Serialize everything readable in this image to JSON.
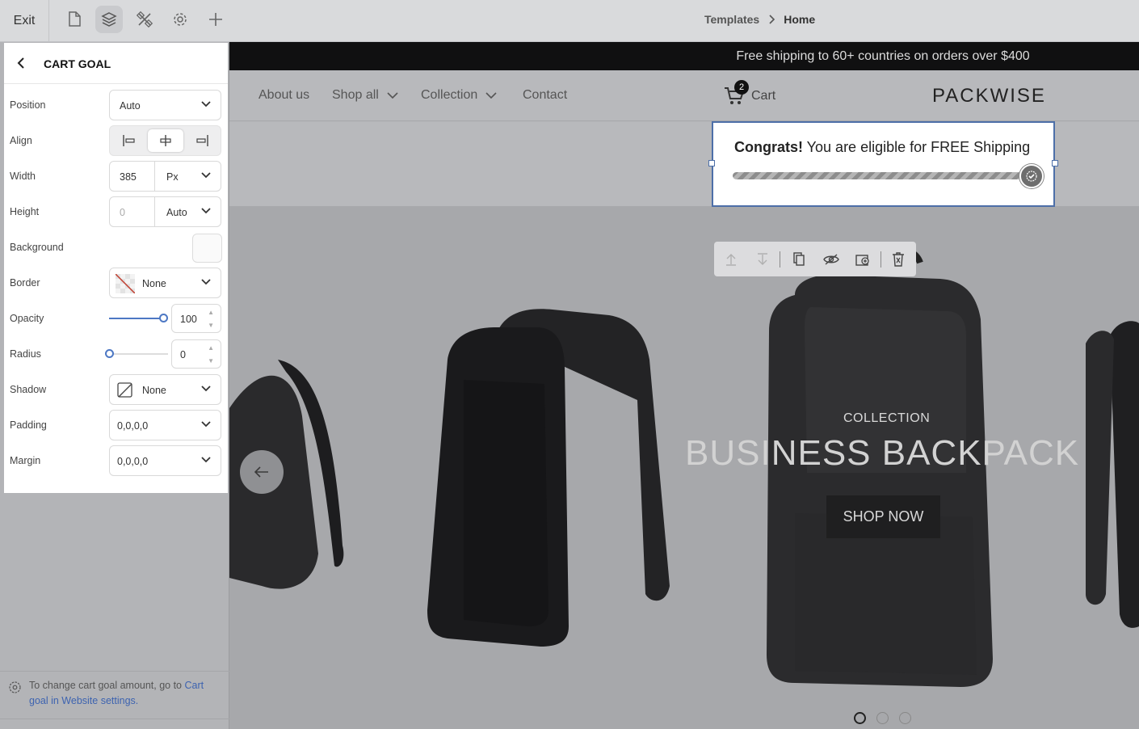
{
  "topbar": {
    "exit_label": "Exit",
    "icons": [
      "page-icon",
      "layers-icon",
      "tools-icon",
      "gear-icon",
      "plus-icon"
    ],
    "breadcrumb": {
      "parent": "Templates",
      "current": "Home"
    }
  },
  "panel": {
    "title": "CART GOAL",
    "position": {
      "label": "Position",
      "value": "Auto"
    },
    "align": {
      "label": "Align",
      "options": [
        "left",
        "center",
        "right"
      ],
      "selected": "center"
    },
    "width": {
      "label": "Width",
      "value": "385",
      "unit": "Px"
    },
    "height": {
      "label": "Height",
      "value": "0",
      "unit": "Auto"
    },
    "background": {
      "label": "Background",
      "color": "#fafafa"
    },
    "border": {
      "label": "Border",
      "value": "None"
    },
    "opacity": {
      "label": "Opacity",
      "value": "100"
    },
    "radius": {
      "label": "Radius",
      "value": "0"
    },
    "shadow": {
      "label": "Shadow",
      "value": "None"
    },
    "padding": {
      "label": "Padding",
      "value": "0,0,0,0"
    },
    "margin": {
      "label": "Margin",
      "value": "0,0,0,0"
    },
    "footnote": {
      "text": "To change cart goal amount, go to ",
      "link": "Cart goal in Website settings."
    }
  },
  "site": {
    "announcement": "Free shipping to 60+ countries on orders over $400",
    "nav": [
      {
        "label": "About us",
        "dropdown": false
      },
      {
        "label": "Shop all",
        "dropdown": true
      },
      {
        "label": "Collection",
        "dropdown": true
      },
      {
        "label": "Contact",
        "dropdown": false
      }
    ],
    "cart": {
      "label": "Cart",
      "count": "2"
    },
    "logo": "PACKWISE",
    "cart_goal": {
      "bold": "Congrats!",
      "text": " You are eligible for FREE Shipping",
      "progress": 1.0
    },
    "hero": {
      "eyebrow": "COLLECTION",
      "title": "BUSINESS BACKPACK",
      "cta": "SHOP NOW",
      "slides": 3,
      "active_slide": 1
    }
  },
  "floating_toolbar": [
    "move-up-icon",
    "move-down-icon",
    "duplicate-icon",
    "hide-icon",
    "add-section-icon",
    "delete-icon"
  ],
  "colors": {
    "accent": "#4d6fa8",
    "slider": "#4d78c4",
    "link": "#3d63b0"
  }
}
